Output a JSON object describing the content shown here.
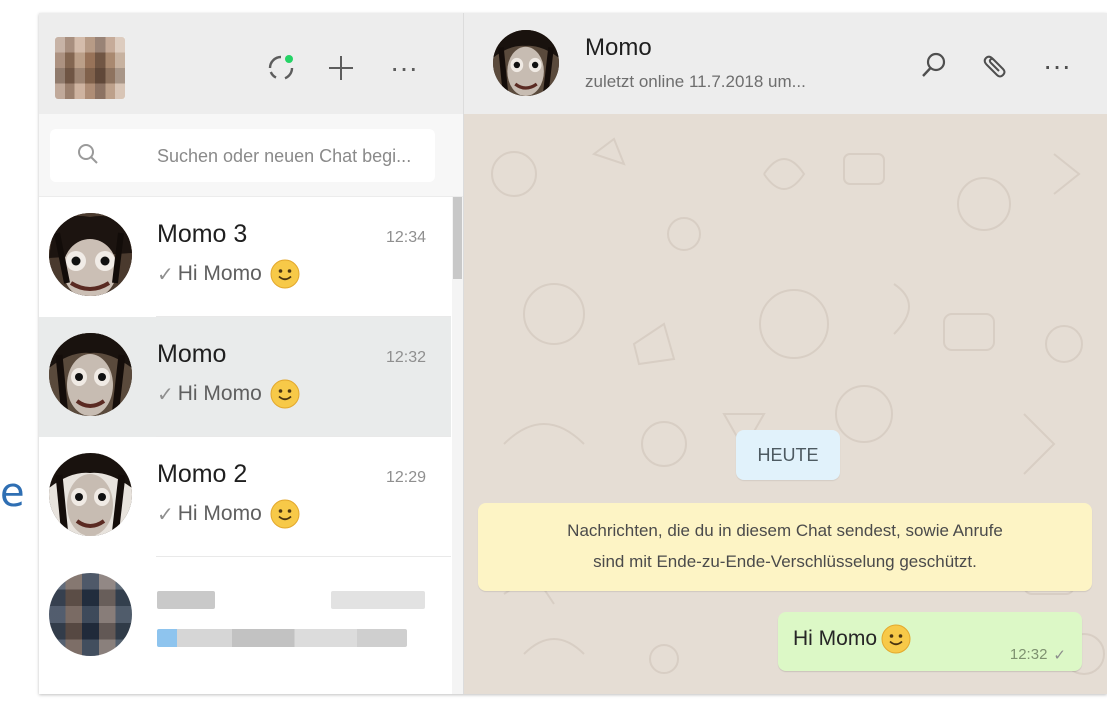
{
  "left_header": {
    "avatar_name": "my-profile-avatar",
    "icons": [
      "status-icon",
      "new-chat-icon",
      "menu-icon"
    ],
    "menu_glyph": "···"
  },
  "search": {
    "placeholder": "Suchen oder neuen Chat begi..."
  },
  "chats": [
    {
      "name": "Momo 3",
      "time": "12:34",
      "preview": "Hi Momo",
      "tick": "✓",
      "active": false
    },
    {
      "name": "Momo",
      "time": "12:32",
      "preview": "Hi Momo",
      "tick": "✓",
      "active": true
    },
    {
      "name": "Momo 2",
      "time": "12:29",
      "preview": "Hi Momo",
      "tick": "✓",
      "active": false
    }
  ],
  "conversation": {
    "name": "Momo",
    "status": "zuletzt online 11.7.2018 um...",
    "menu_glyph": "···",
    "date_chip": "HEUTE",
    "system_message_line1": "Nachrichten, die du in diesem Chat sendest, sowie Anrufe",
    "system_message_line2": "sind mit Ende-zu-Ende-Verschlüsselung geschützt.",
    "message": {
      "text": "Hi Momo",
      "time": "12:32",
      "tick": "✓"
    }
  },
  "stray_text": "e",
  "colors": {
    "header_bg": "#ededed",
    "chat_bg": "#e5ddd4",
    "outgoing_bubble": "#dcf8c6",
    "system_bubble": "#fdf4c5",
    "date_chip": "#e1f2fb",
    "active_chat": "#e9ebeb",
    "status_dot": "#25d366"
  }
}
